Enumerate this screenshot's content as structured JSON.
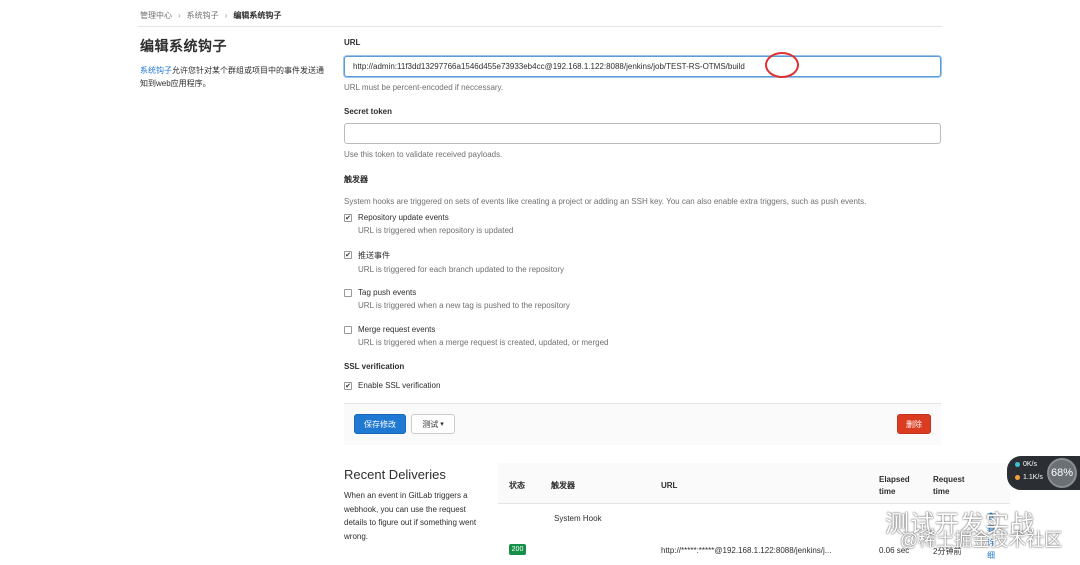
{
  "breadcrumb": [
    "管理中心",
    "系统钩子",
    "编辑系统钩子"
  ],
  "sidebar": {
    "title": "编辑系统钩子",
    "link_text": "系统钩子",
    "desc_rest": "允许您针对某个群组或项目中的事件发送通知到web应用程序。"
  },
  "url_field": {
    "label": "URL",
    "value": "http://admin:11f3dd13297766a1546d455e73933eb4cc@192.168.1.122:8088/jenkins/job/TEST-RS-OTMS/build",
    "help": "URL must be percent-encoded if neccessary."
  },
  "token_field": {
    "label": "Secret token",
    "value": "",
    "help": "Use this token to validate received payloads."
  },
  "triggers": {
    "label": "触发器",
    "help": "System hooks are triggered on sets of events like creating a project or adding an SSH key. You can also enable extra triggers, such as push events.",
    "items": [
      {
        "title": "Repository update events",
        "help": "URL is triggered when repository is updated",
        "checked": true
      },
      {
        "title": "推送事件",
        "help": "URL is triggered for each branch updated to the repository",
        "checked": true
      },
      {
        "title": "Tag push events",
        "help": "URL is triggered when a new tag is pushed to the repository",
        "checked": false
      },
      {
        "title": "Merge request events",
        "help": "URL is triggered when a merge request is created, updated, or merged",
        "checked": false
      }
    ]
  },
  "ssl": {
    "label": "SSL verification",
    "option": "Enable SSL verification",
    "checked": true
  },
  "buttons": {
    "save": "保存修改",
    "test": "测试",
    "delete": "删除"
  },
  "deliveries": {
    "title": "Recent Deliveries",
    "desc": "When an event in GitLab triggers a webhook, you can use the request details to figure out if something went wrong.",
    "headers": {
      "status": "状态",
      "trigger": "触发器",
      "url": "URL",
      "elapsed": "Elapsed time",
      "request": "Request time"
    },
    "rows": [
      {
        "status": "200",
        "trigger": "System Hook",
        "url": "http://*****:*****@192.168.1.122:8088/jenkins/j...",
        "elapsed": "0.06 sec",
        "request": "2分钟前",
        "action": "查看详细"
      }
    ]
  },
  "net_widget": {
    "up": "0K/s",
    "down": "1.1K/s",
    "percent": "68%"
  },
  "watermark": {
    "line1": "测试开发实战",
    "line2": "@稀土掘金技术社区"
  },
  "colors": {
    "primary": "#1f78d1",
    "danger": "#db3b21",
    "success": "#168f48",
    "annotation": "#e0302f"
  }
}
